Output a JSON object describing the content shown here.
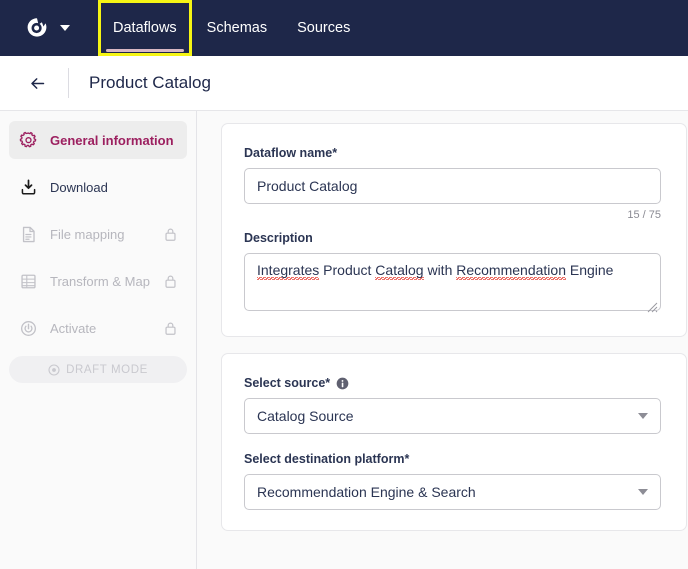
{
  "topnav": {
    "logo_icon": "owl-eye-logo-icon",
    "caret_icon": "chevron-down-icon",
    "tabs": [
      {
        "label": "Dataflows",
        "active": true,
        "focused": true
      },
      {
        "label": "Schemas",
        "active": false,
        "focused": false
      },
      {
        "label": "Sources",
        "active": false,
        "focused": false
      }
    ],
    "bg_color": "#1e2749",
    "focus_ring_color": "#f5f514",
    "active_underline_color": "#d9b8c4"
  },
  "page_header": {
    "back_icon": "arrow-left-icon",
    "title": "Product Catalog"
  },
  "sidebar": {
    "items": [
      {
        "label": "General information",
        "icon": "gear-icon",
        "active": true,
        "locked": false
      },
      {
        "label": "Download",
        "icon": "download-icon",
        "active": false,
        "locked": false
      },
      {
        "label": "File mapping",
        "icon": "document-icon",
        "active": false,
        "locked": true
      },
      {
        "label": "Transform & Map",
        "icon": "table-icon",
        "active": false,
        "locked": true
      },
      {
        "label": "Activate",
        "icon": "power-icon",
        "active": false,
        "locked": true
      }
    ],
    "lock_icon": "lock-icon",
    "draft_badge": {
      "label": "DRAFT MODE",
      "icon": "dot-circle-icon"
    },
    "active_color": "#9c1f5f"
  },
  "form": {
    "name_field": {
      "label": "Dataflow name*",
      "value": "Product Catalog",
      "placeholder": "",
      "counter": "15 / 75"
    },
    "description_field": {
      "label": "Description",
      "value": "Integrates Product Catalog with Recommendation Engine",
      "placeholder": "",
      "spellcheck_words": [
        "Integrates",
        "Catalog",
        "Recommendation"
      ],
      "resize_handle_icon": "resize-grip-icon"
    },
    "source_field": {
      "label": "Select source*",
      "info_icon": "info-icon",
      "value": "Catalog Source",
      "caret_icon": "chevron-down-icon"
    },
    "destination_field": {
      "label": "Select destination platform*",
      "value": "Recommendation Engine & Search",
      "caret_icon": "chevron-down-icon"
    }
  }
}
